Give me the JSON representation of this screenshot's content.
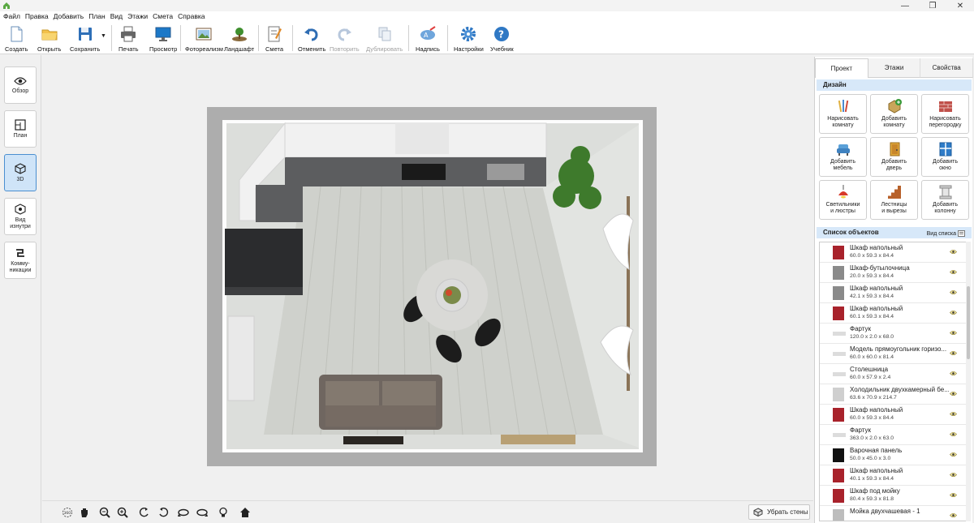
{
  "window": {
    "minimize": "—",
    "maximize": "❐",
    "close": "✕"
  },
  "menu": [
    "Файл",
    "Правка",
    "Добавить",
    "План",
    "Вид",
    "Этажи",
    "Смета",
    "Справка"
  ],
  "toolbar": {
    "create": "Создать",
    "open": "Открыть",
    "save": "Сохранить",
    "print": "Печать",
    "preview": "Просмотр",
    "photorealism": "Фотореализм",
    "landscape": "Ландшафт",
    "estimate": "Смета",
    "undo": "Отменить",
    "redo": "Повторить",
    "duplicate": "Дублировать",
    "label": "Надпись",
    "settings": "Настройки",
    "tutorial": "Учебник"
  },
  "left_panel": {
    "overview": "Обзор",
    "plan": "План",
    "view3d": "3D",
    "inside": [
      "Вид",
      "изнутри"
    ],
    "comms": [
      "Комму-",
      "никации"
    ]
  },
  "bottom": {
    "remove_walls": "Убрать стены",
    "rotate360": "360"
  },
  "right_panel": {
    "tabs": [
      "Проект",
      "Этажи",
      "Свойства"
    ],
    "design_header": "Дизайн",
    "design_buttons": [
      [
        "Нарисовать",
        "комнату"
      ],
      [
        "Добавить",
        "комнату"
      ],
      [
        "Нарисовать",
        "перегородку"
      ],
      [
        "Добавить",
        "мебель"
      ],
      [
        "Добавить",
        "дверь"
      ],
      [
        "Добавить",
        "окно"
      ],
      [
        "Светильники",
        "и люстры"
      ],
      [
        "Лестницы",
        "и вырезы"
      ],
      [
        "Добавить",
        "колонну"
      ]
    ],
    "objects_header": "Список объектов",
    "list_view": "Вид списка",
    "objects": [
      {
        "name": "Шкаф напольный",
        "dims": "60.0 x 59.3 x 84.4",
        "thumb": "#a8222b"
      },
      {
        "name": "Шкаф-бутылочница",
        "dims": "20.0 x 59.3 x 84.4",
        "thumb": "#8a8a8a"
      },
      {
        "name": "Шкаф напольный",
        "dims": "42.1 x 59.3 x 84.4",
        "thumb": "#8a8a8a"
      },
      {
        "name": "Шкаф напольный",
        "dims": "60.1 x 59.3 x 84.4",
        "thumb": "#a8222b"
      },
      {
        "name": "Фартук",
        "dims": "120.0 x 2.0 x 68.0",
        "thumb": "#dcdcdc"
      },
      {
        "name": "Модель прямоугольник горизо...",
        "dims": "60.0 x 60.0 x 81.4",
        "thumb": "#dcdcdc"
      },
      {
        "name": "Столешница",
        "dims": "60.0 x 57.9 x 2.4",
        "thumb": "#dcdcdc"
      },
      {
        "name": "Холодильник двухкамерный бе...",
        "dims": "63.6 x 70.9 x 214.7",
        "thumb": "#cfcfcf"
      },
      {
        "name": "Шкаф напольный",
        "dims": "60.0 x 59.3 x 84.4",
        "thumb": "#a8222b"
      },
      {
        "name": "Фартук",
        "dims": "363.0 x 2.0 x 63.0",
        "thumb": "#dcdcdc"
      },
      {
        "name": "Варочная панель",
        "dims": "50.0 x 45.0 x 3.0",
        "thumb": "#111111"
      },
      {
        "name": "Шкаф напольный",
        "dims": "40.1 x 59.3 x 84.4",
        "thumb": "#a8222b"
      },
      {
        "name": "Шкаф под мойку",
        "dims": "80.4 x 59.3 x 81.8",
        "thumb": "#a8222b"
      },
      {
        "name": "Мойка двухчашевая - 1",
        "dims": "",
        "thumb": "#bdbdbd"
      }
    ]
  },
  "colors": {
    "accent": "#2f7fd0",
    "active_bg": "#cfe4f8",
    "section_bg": "#d7e8f9"
  }
}
